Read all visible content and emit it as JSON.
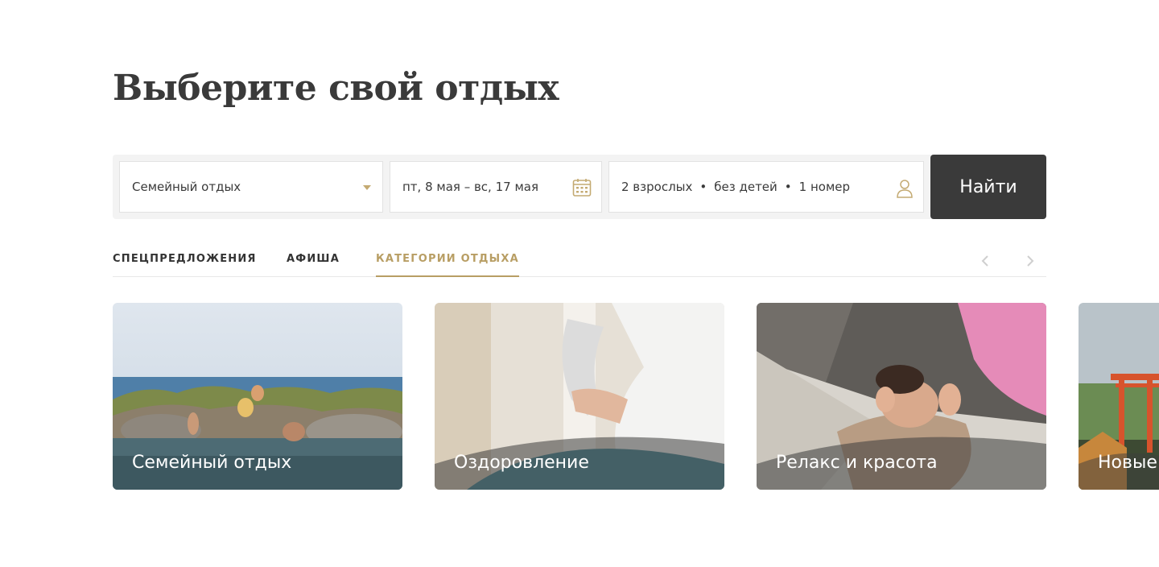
{
  "page": {
    "title": "Выберите свой отдых"
  },
  "search": {
    "vacation_type": "Семейный отдых",
    "dates": "пт, 8 мая – вс, 17 мая",
    "guests": {
      "adults": "2 взрослых",
      "children": "без детей",
      "rooms": "1 номер",
      "separator": "•"
    },
    "submit_label": "Найти"
  },
  "tabs": [
    {
      "label": "СПЕЦПРЕДЛОЖЕНИЯ",
      "active": false
    },
    {
      "label": "АФИША",
      "active": false
    },
    {
      "label": "КАТЕГОРИИ ОТДЫХА",
      "active": true
    }
  ],
  "carousel": {
    "prev_icon": "chevron-left-icon",
    "next_icon": "chevron-right-icon",
    "cards": [
      {
        "label": "Семейный отдых"
      },
      {
        "label": "Оздоровление"
      },
      {
        "label": "Релакс и красота"
      },
      {
        "label": "Новые"
      }
    ]
  },
  "colors": {
    "accent": "#b89e64",
    "dark": "#3a3a3a",
    "bar_background": "#f3f3f3",
    "text": "#333333"
  },
  "icons": {
    "dropdown": "caret-down-icon",
    "calendar": "calendar-icon",
    "guests": "person-icon"
  }
}
